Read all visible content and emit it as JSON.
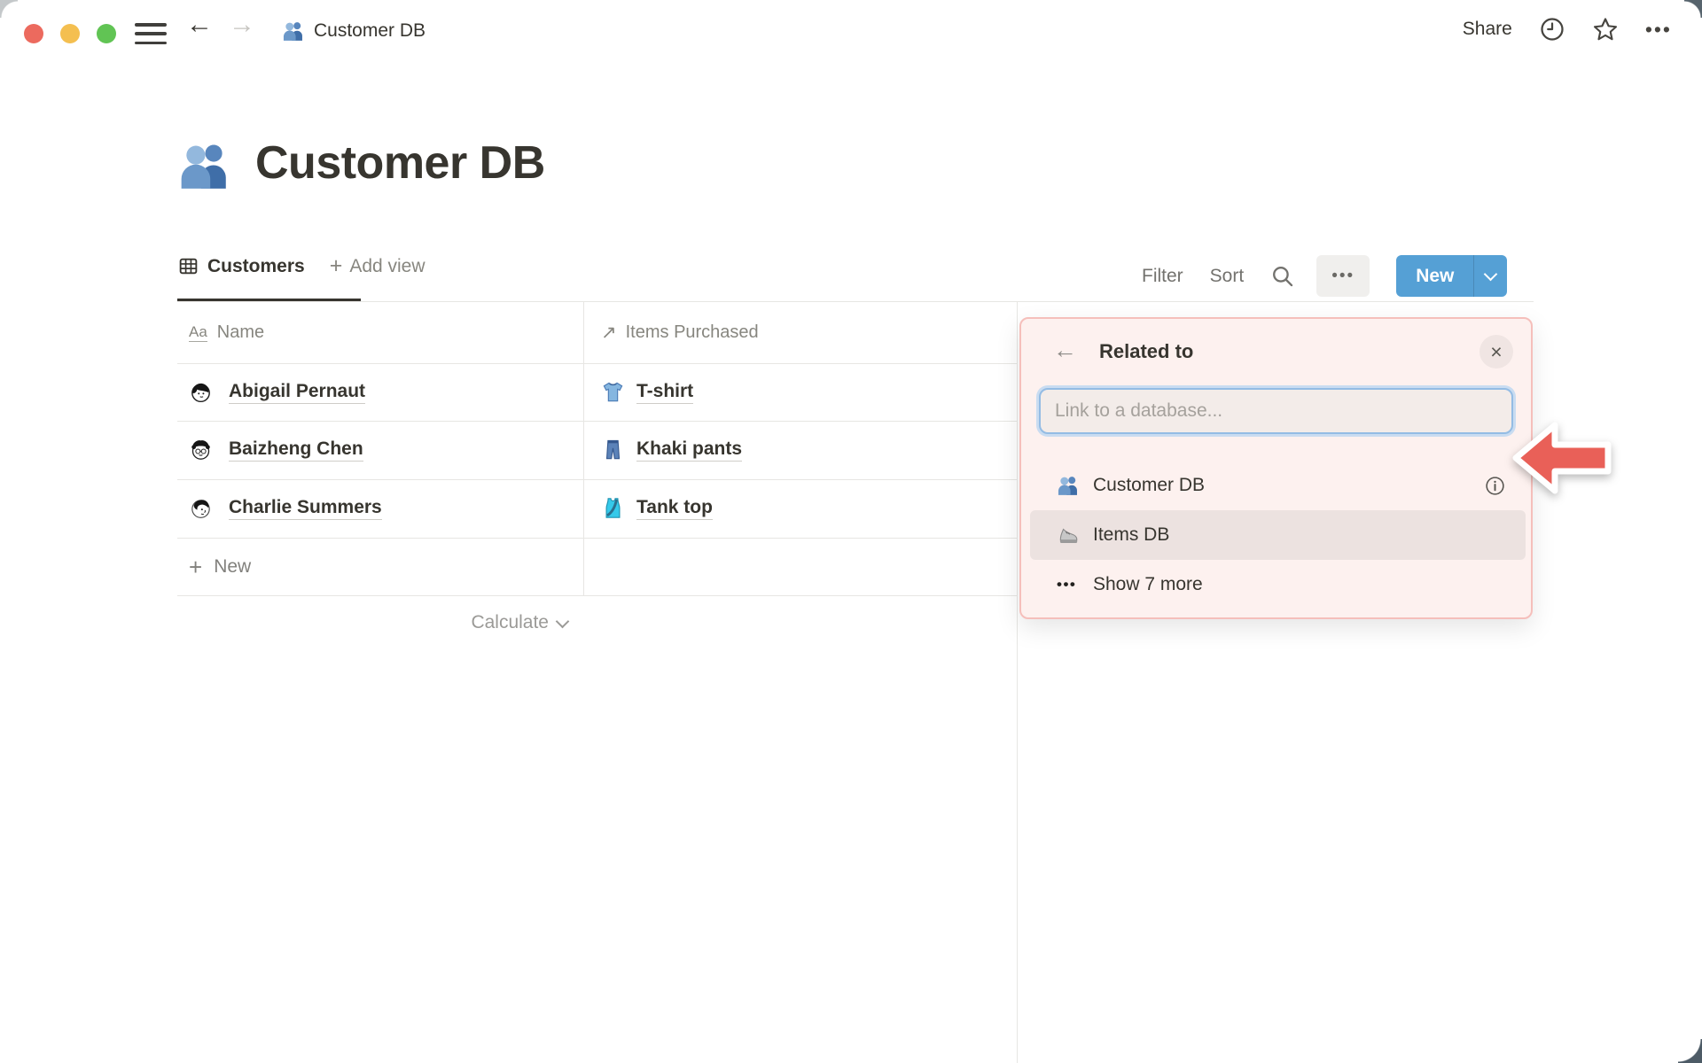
{
  "colors": {
    "accent_blue": "#55A0D5",
    "popup_bg": "#FDF1EF",
    "popup_border": "#F5BFBB",
    "popup_highlight": "#ECE2E0",
    "input_focus_ring": "#94BCE4",
    "annotation_arrow_red": "#E96058",
    "traffic_red": "#EC6A5E",
    "traffic_yellow": "#F4BF50",
    "traffic_green": "#61C454"
  },
  "icons": {
    "back": "←",
    "forward": "→",
    "plus": "+",
    "ellipsis": "•••",
    "close": "×",
    "relation": "↗",
    "text_property": "Aa"
  },
  "topbar": {
    "breadcrumb": {
      "icon": "people-icon",
      "label": "Customer DB"
    },
    "share_label": "Share"
  },
  "page": {
    "icon": "people-icon",
    "title": "Customer DB"
  },
  "toolbar": {
    "tab_label": "Customers",
    "add_view_label": "Add view",
    "filter_label": "Filter",
    "sort_label": "Sort",
    "new_label": "New"
  },
  "table": {
    "columns": [
      {
        "label": "Name",
        "icon": "text-property-icon"
      },
      {
        "label": "Items Purchased",
        "icon": "relation-icon"
      }
    ],
    "rows": [
      {
        "name": "Abigail Pernaut",
        "name_icon": "avatar-abigail-icon",
        "item": "T-shirt",
        "item_icon": "tshirt-icon"
      },
      {
        "name": "Baizheng Chen",
        "name_icon": "avatar-baizheng-icon",
        "item": "Khaki pants",
        "item_icon": "jeans-icon"
      },
      {
        "name": "Charlie Summers",
        "name_icon": "avatar-charlie-icon",
        "item": "Tank top",
        "item_icon": "tanktop-icon"
      }
    ],
    "new_row_label": "New",
    "calculate_label": "Calculate"
  },
  "popup": {
    "title": "Related to",
    "search_placeholder": "Link to a database...",
    "options": [
      {
        "label": "Customer DB",
        "icon": "people-icon",
        "has_info": true
      },
      {
        "label": "Items DB",
        "icon": "shoe-icon",
        "highlighted": true
      },
      {
        "label": "Show 7 more",
        "icon": "ellipsis-icon"
      }
    ]
  }
}
